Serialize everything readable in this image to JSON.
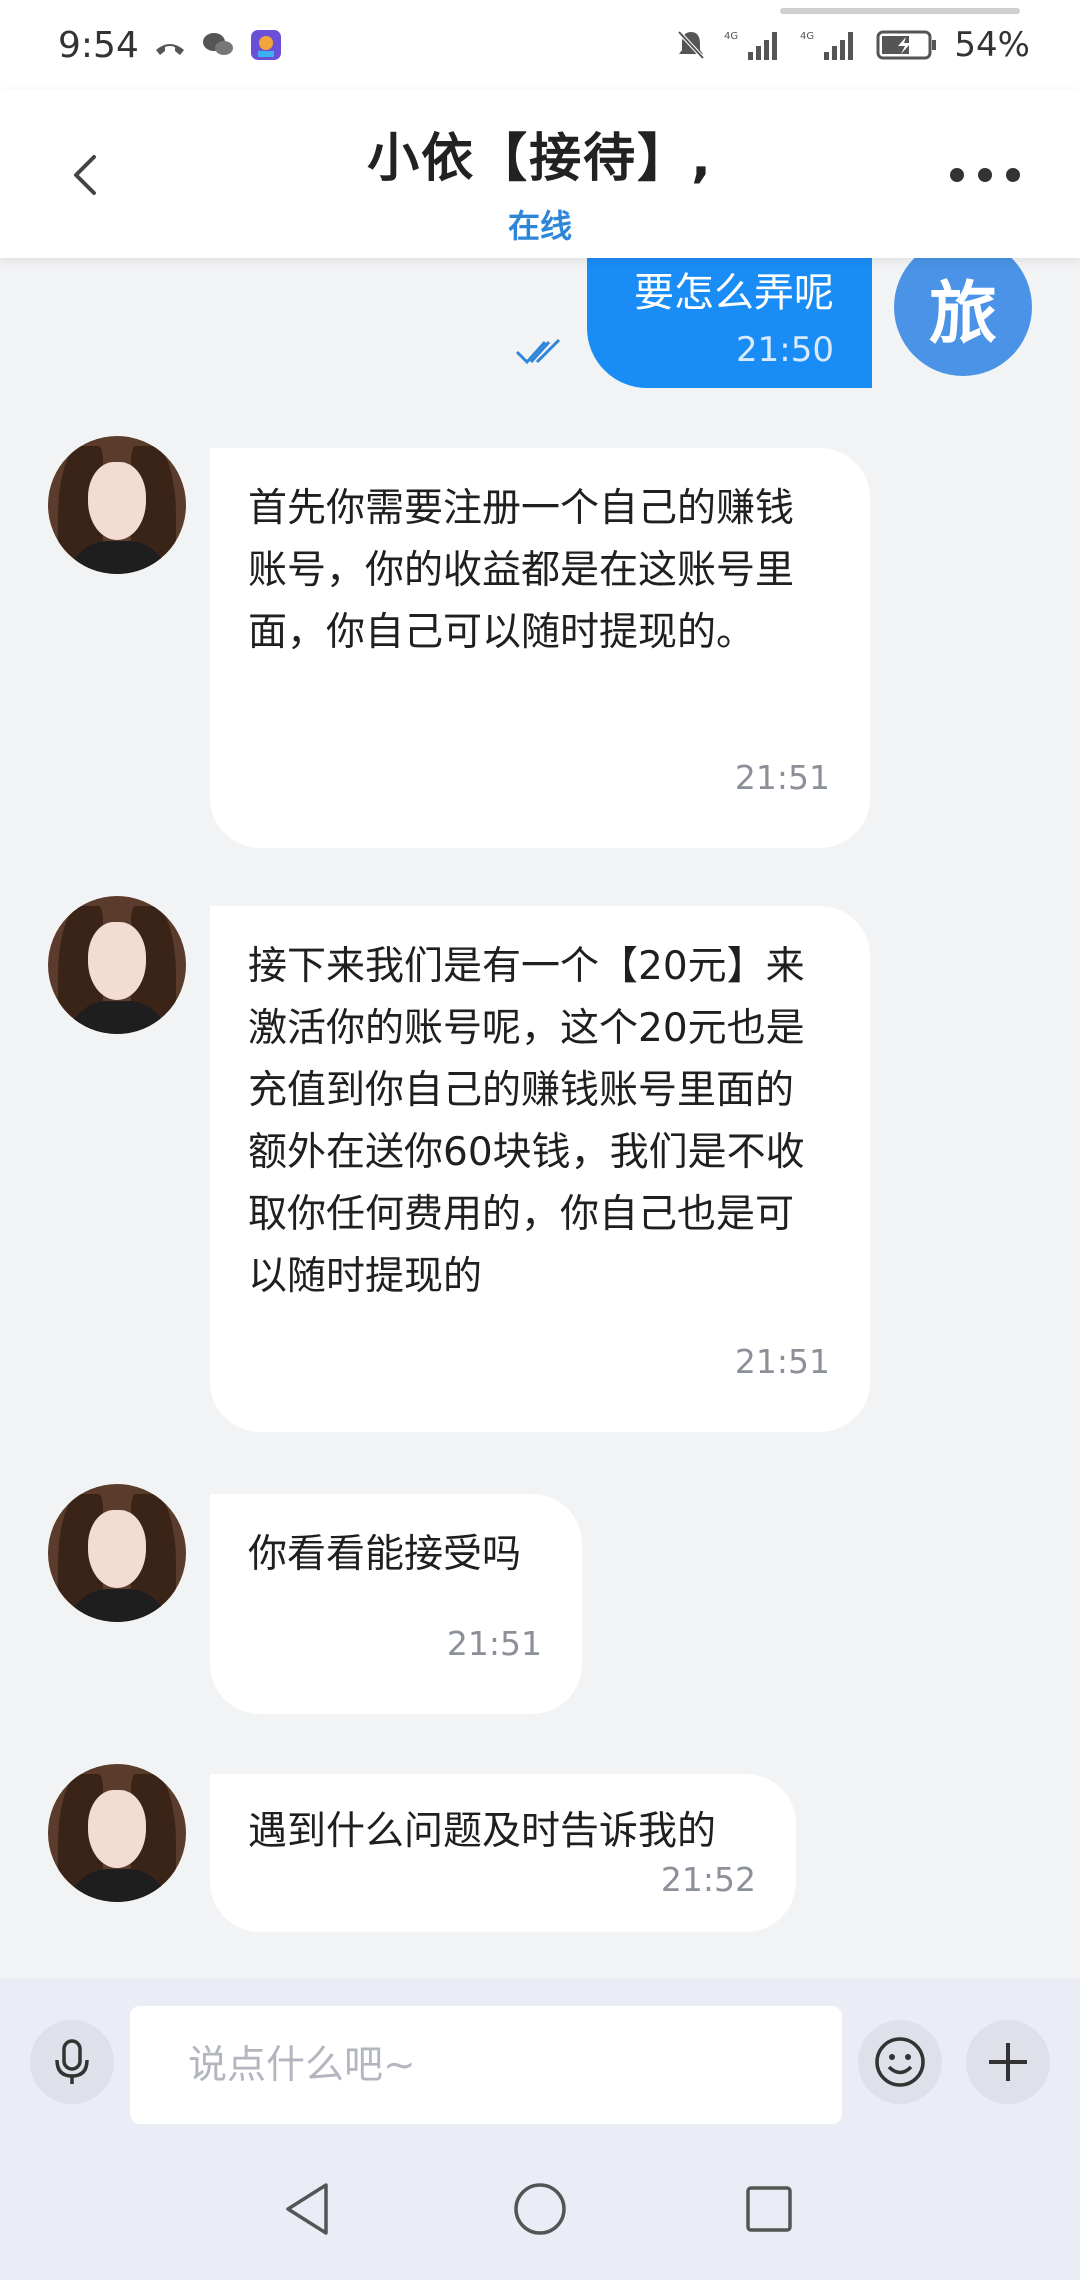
{
  "status_bar": {
    "time": "9:54",
    "battery": "54%",
    "network_1": "4G",
    "network_2": "4G"
  },
  "header": {
    "title": "小依【接待】,",
    "status": "在线"
  },
  "self": {
    "avatar_text": "旅"
  },
  "messages": [
    {
      "from": "self",
      "text": "要怎么弄呢",
      "time": "21:50"
    },
    {
      "from": "other",
      "text": "首先你需要注册一个自己的赚钱账号，你的收益都是在这账号里面，你自己可以随时提现的。",
      "time": "21:51"
    },
    {
      "from": "other",
      "text": "接下来我们是有一个【20元】来激活你的账号呢，这个20元也是充值到你自己的赚钱账号里面的额外在送你60块钱，我们是不收取你任何费用的，你自己也是可以随时提现的",
      "time": "21:51"
    },
    {
      "from": "other",
      "text": "你看看能接受吗",
      "time": "21:51"
    },
    {
      "from": "other",
      "text": "遇到什么问题及时告诉我的",
      "time": "21:52"
    }
  ],
  "input": {
    "placeholder": "说点什么吧~"
  },
  "colors": {
    "accent": "#1a8cf5",
    "online": "#2f86d8",
    "self_avatar": "#4b93e6"
  }
}
